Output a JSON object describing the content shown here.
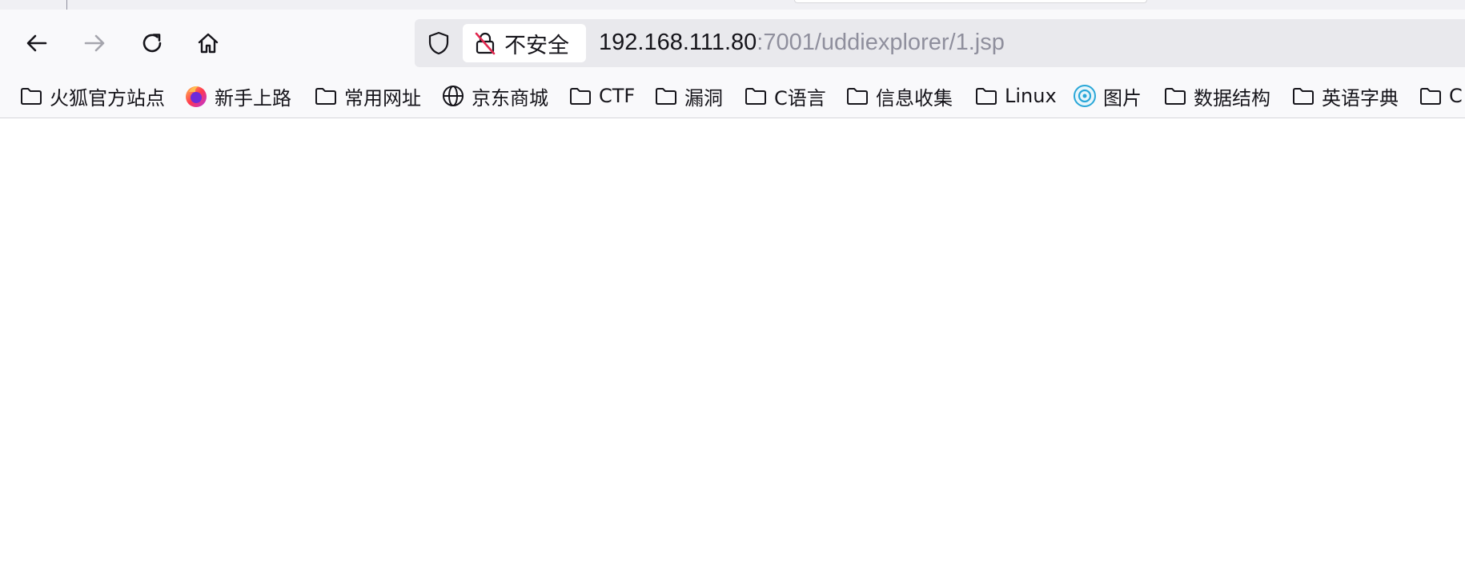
{
  "browser": {
    "toolbar": {
      "back_icon": "arrow-left-icon",
      "forward_icon": "arrow-right-icon",
      "reload_icon": "reload-icon",
      "home_icon": "home-icon"
    },
    "urlbar": {
      "security_label": "不安全",
      "url_host": "192.168.111.80",
      "url_path": ":7001/uddiexplorer/1.jsp"
    },
    "bookmarks": [
      {
        "label": "火狐官方站点",
        "icon": "folder-icon"
      },
      {
        "label": "新手上路",
        "icon": "firefox-icon"
      },
      {
        "label": "常用网址",
        "icon": "folder-icon"
      },
      {
        "label": "京东商城",
        "icon": "globe-icon"
      },
      {
        "label": "CTF",
        "icon": "folder-icon"
      },
      {
        "label": "漏洞",
        "icon": "folder-icon"
      },
      {
        "label": "C语言",
        "icon": "folder-icon"
      },
      {
        "label": "信息收集",
        "icon": "folder-icon"
      },
      {
        "label": "Linux",
        "icon": "folder-icon"
      },
      {
        "label": "图片",
        "icon": "image-site-icon"
      },
      {
        "label": "数据结构",
        "icon": "folder-icon"
      },
      {
        "label": "英语字典",
        "icon": "folder-icon"
      },
      {
        "label": "C",
        "icon": "folder-icon"
      }
    ]
  },
  "colors": {
    "toolbar_bg": "#f9f9fb",
    "urlbar_bg": "#e9e9ed",
    "text": "#15141a",
    "url_dim": "#8f8f9d",
    "insecure_red": "#e22850"
  }
}
